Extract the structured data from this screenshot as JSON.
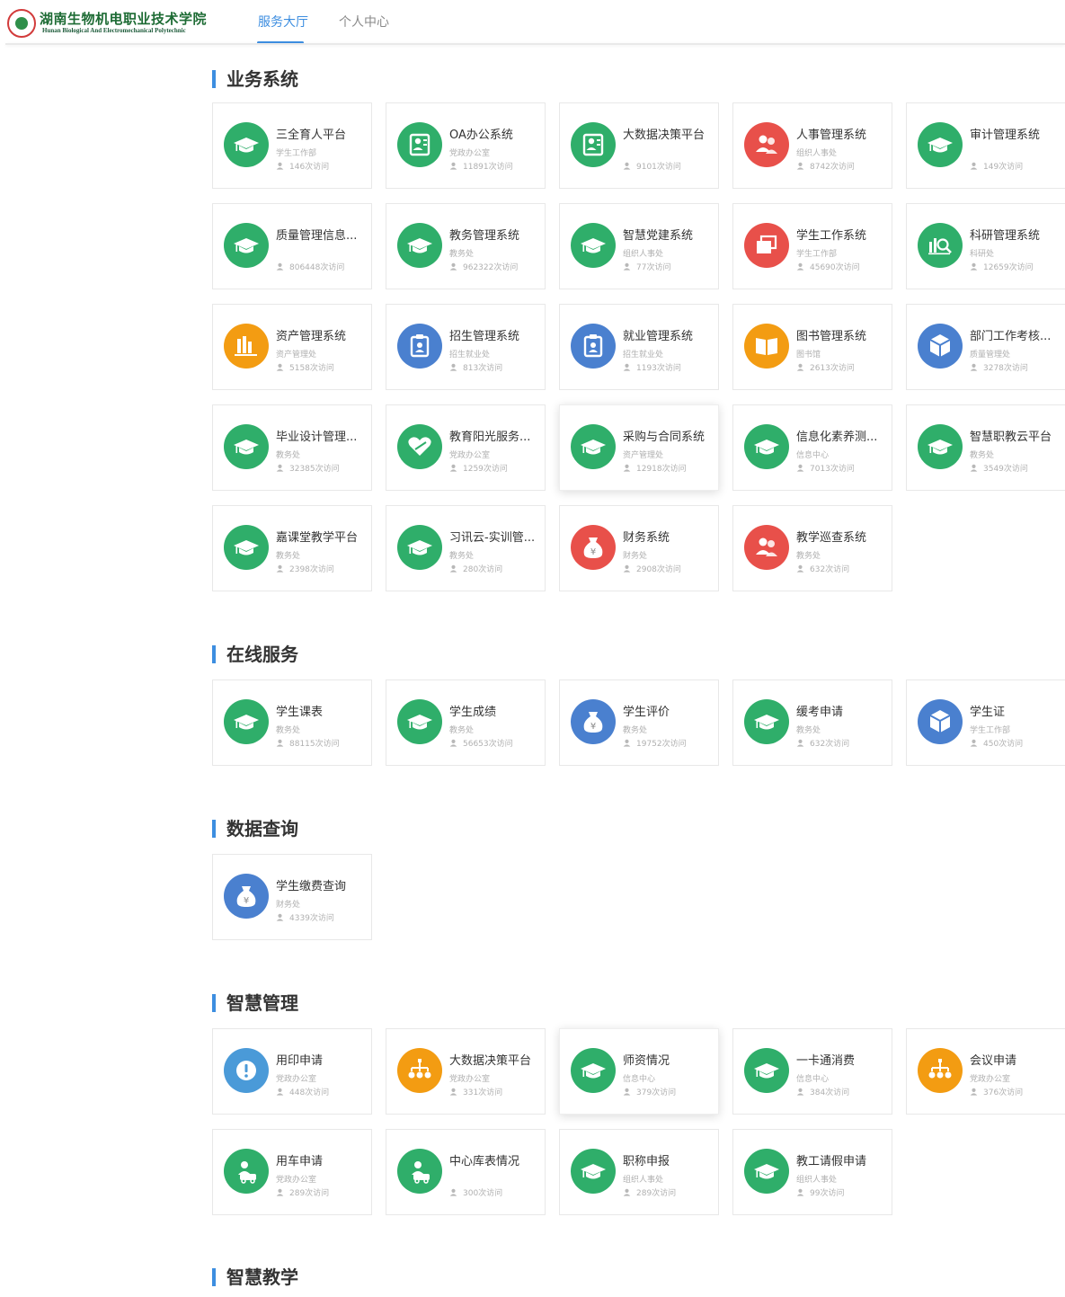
{
  "logo": {
    "cn": "湖南生物机电职业技术学院",
    "en": "Hunan Biological And Electromechanical Polytechnic"
  },
  "nav": {
    "tabs": [
      {
        "label": "服务大厅",
        "active": true
      },
      {
        "label": "个人中心",
        "active": false
      }
    ]
  },
  "colors": {
    "accent": "#3d8ee0",
    "green": "#2fae6a",
    "red": "#e8504a",
    "orange": "#f39c12",
    "blue": "#4a80cf"
  },
  "sections": [
    {
      "title": "业务系统",
      "cards": [
        {
          "title": "三全育人平台",
          "dept": "学生工作部",
          "visits": "146次访问",
          "icon": "graduation-cap-icon",
          "color": "#2fae6a"
        },
        {
          "title": "OA办公系统",
          "dept": "党政办公室",
          "visits": "11891次访问",
          "icon": "id-card-icon",
          "color": "#2fae6a"
        },
        {
          "title": "大数据决策平台",
          "dept": "",
          "visits": "9101次访问",
          "icon": "id-card-icon",
          "color": "#2fae6a"
        },
        {
          "title": "人事管理系统",
          "dept": "组织人事处",
          "visits": "8742次访问",
          "icon": "people-icon",
          "color": "#e8504a"
        },
        {
          "title": "审计管理系统",
          "dept": "",
          "visits": "149次访问",
          "icon": "graduation-cap-icon",
          "color": "#2fae6a"
        },
        {
          "title": "质量管理信息...",
          "dept": "",
          "visits": "806448次访问",
          "icon": "graduation-cap-icon",
          "color": "#2fae6a"
        },
        {
          "title": "教务管理系统",
          "dept": "教务处",
          "visits": "962322次访问",
          "icon": "graduation-cap-icon",
          "color": "#2fae6a"
        },
        {
          "title": "智慧党建系统",
          "dept": "组织人事处",
          "visits": "77次访问",
          "icon": "graduation-cap-icon",
          "color": "#2fae6a"
        },
        {
          "title": "学生工作系统",
          "dept": "学生工作部",
          "visits": "45690次访问",
          "icon": "windows-icon",
          "color": "#e8504a"
        },
        {
          "title": "科研管理系统",
          "dept": "科研处",
          "visits": "12659次访问",
          "icon": "search-chart-icon",
          "color": "#2fae6a"
        },
        {
          "title": "资产管理系统",
          "dept": "资产管理处",
          "visits": "5158次访问",
          "icon": "bar-chart-icon",
          "color": "#f39c12"
        },
        {
          "title": "招生管理系统",
          "dept": "招生就业处",
          "visits": "813次访问",
          "icon": "badge-icon",
          "color": "#4a80cf"
        },
        {
          "title": "就业管理系统",
          "dept": "招生就业处",
          "visits": "1193次访问",
          "icon": "badge-icon",
          "color": "#4a80cf"
        },
        {
          "title": "图书管理系统",
          "dept": "图书馆",
          "visits": "2613次访问",
          "icon": "book-icon",
          "color": "#f39c12"
        },
        {
          "title": "部门工作考核...",
          "dept": "质量管理处",
          "visits": "3278次访问",
          "icon": "cube-icon",
          "color": "#4a80cf"
        },
        {
          "title": "毕业设计管理...",
          "dept": "教务处",
          "visits": "32385次访问",
          "icon": "graduation-cap-icon",
          "color": "#2fae6a"
        },
        {
          "title": "教育阳光服务...",
          "dept": "党政办公室",
          "visits": "1259次访问",
          "icon": "heart-icon",
          "color": "#2fae6a"
        },
        {
          "title": "采购与合同系统",
          "dept": "资产管理处",
          "visits": "12918次访问",
          "icon": "graduation-cap-icon",
          "color": "#2fae6a"
        },
        {
          "title": "信息化素养测...",
          "dept": "信息中心",
          "visits": "7013次访问",
          "icon": "graduation-cap-icon",
          "color": "#2fae6a"
        },
        {
          "title": "智慧职教云平台",
          "dept": "教务处",
          "visits": "3549次访问",
          "icon": "graduation-cap-icon",
          "color": "#2fae6a"
        },
        {
          "title": "嘉课堂教学平台",
          "dept": "教务处",
          "visits": "2398次访问",
          "icon": "graduation-cap-icon",
          "color": "#2fae6a"
        },
        {
          "title": "习讯云-实训管...",
          "dept": "教务处",
          "visits": "280次访问",
          "icon": "graduation-cap-icon",
          "color": "#2fae6a"
        },
        {
          "title": "财务系统",
          "dept": "财务处",
          "visits": "2908次访问",
          "icon": "money-bag-icon",
          "color": "#e8504a"
        },
        {
          "title": "教学巡查系统",
          "dept": "教务处",
          "visits": "632次访问",
          "icon": "people-icon",
          "color": "#e8504a"
        }
      ]
    },
    {
      "title": "在线服务",
      "cards": [
        {
          "title": "学生课表",
          "dept": "教务处",
          "visits": "88115次访问",
          "icon": "graduation-cap-icon",
          "color": "#2fae6a"
        },
        {
          "title": "学生成绩",
          "dept": "教务处",
          "visits": "56653次访问",
          "icon": "graduation-cap-icon",
          "color": "#2fae6a"
        },
        {
          "title": "学生评价",
          "dept": "教务处",
          "visits": "19752次访问",
          "icon": "money-bag-icon",
          "color": "#4a80cf"
        },
        {
          "title": "缓考申请",
          "dept": "教务处",
          "visits": "632次访问",
          "icon": "graduation-cap-icon",
          "color": "#2fae6a"
        },
        {
          "title": "学生证",
          "dept": "学生工作部",
          "visits": "450次访问",
          "icon": "cube-icon",
          "color": "#4a80cf"
        }
      ]
    },
    {
      "title": "数据查询",
      "cards": [
        {
          "title": "学生缴费查询",
          "dept": "财务处",
          "visits": "4339次访问",
          "icon": "money-bag-icon",
          "color": "#4a80cf"
        }
      ]
    },
    {
      "title": "智慧管理",
      "cards": [
        {
          "title": "用印申请",
          "dept": "党政办公室",
          "visits": "448次访问",
          "icon": "alert-icon",
          "color": "#4a9ad8"
        },
        {
          "title": "大数据决策平台",
          "dept": "党政办公室",
          "visits": "331次访问",
          "icon": "org-chart-icon",
          "color": "#f39c12"
        },
        {
          "title": "师资情况",
          "dept": "信息中心",
          "visits": "379次访问",
          "icon": "graduation-cap-icon",
          "color": "#2fae6a"
        },
        {
          "title": "一卡通消费",
          "dept": "信息中心",
          "visits": "384次访问",
          "icon": "graduation-cap-icon",
          "color": "#2fae6a"
        },
        {
          "title": "会议申请",
          "dept": "党政办公室",
          "visits": "376次访问",
          "icon": "org-chart-icon",
          "color": "#f39c12"
        },
        {
          "title": "用车申请",
          "dept": "党政办公室",
          "visits": "289次访问",
          "icon": "car-user-icon",
          "color": "#2fae6a"
        },
        {
          "title": "中心库表情况",
          "dept": "",
          "visits": "300次访问",
          "icon": "car-user-icon",
          "color": "#2fae6a"
        },
        {
          "title": "职称申报",
          "dept": "组织人事处",
          "visits": "289次访问",
          "icon": "graduation-cap-icon",
          "color": "#2fae6a"
        },
        {
          "title": "教工请假申请",
          "dept": "组织人事处",
          "visits": "99次访问",
          "icon": "graduation-cap-icon",
          "color": "#2fae6a"
        }
      ]
    },
    {
      "title": "智慧教学",
      "cards": []
    }
  ]
}
